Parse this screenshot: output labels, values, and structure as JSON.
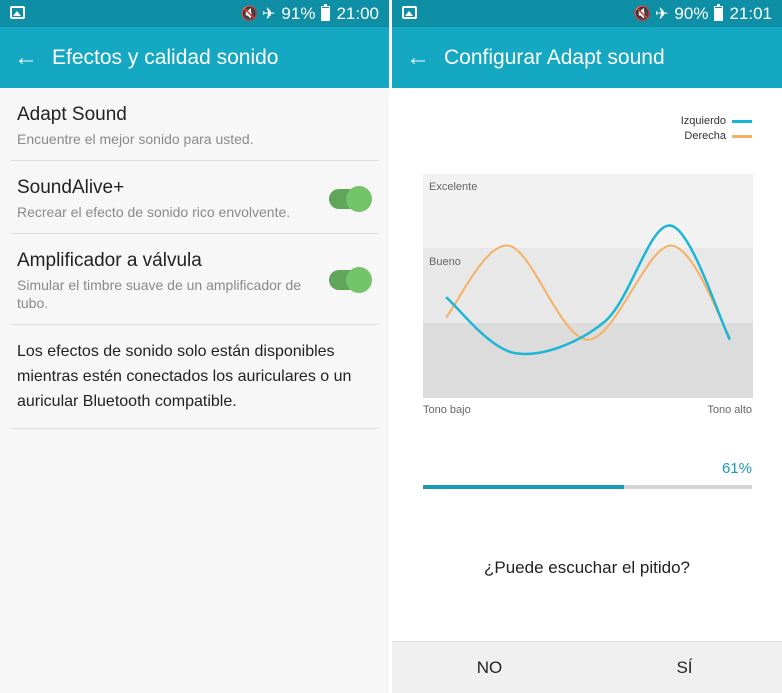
{
  "left": {
    "status": {
      "battery": "91%",
      "time": "21:00"
    },
    "appbar": {
      "title": "Efectos y calidad sonido"
    },
    "items": [
      {
        "title": "Adapt Sound",
        "subtitle": "Encuentre el mejor sonido para usted."
      },
      {
        "title": "SoundAlive+",
        "subtitle": "Recrear el efecto de sonido rico envolvente.",
        "toggle_on": true
      },
      {
        "title": "Amplificador a válvula",
        "subtitle": "Simular el timbre suave de un amplificador de tubo.",
        "toggle_on": true
      }
    ],
    "info": "Los efectos de sonido solo están disponibles mientras estén conectados los auriculares o un auricular Bluetooth compatible."
  },
  "right": {
    "status": {
      "battery": "90%",
      "time": "21:01"
    },
    "appbar": {
      "title": "Configurar Adapt sound"
    },
    "progress": {
      "label": "61%",
      "value": 0.61
    },
    "question": "¿Puede escuchar el pitido?",
    "buttons": {
      "no": "NO",
      "yes": "SÍ"
    }
  },
  "chart_data": {
    "type": "line",
    "bands": [
      "Excelente",
      "Bueno"
    ],
    "x_min_label": "Tono bajo",
    "x_max_label": "Tono alto",
    "xlim": [
      0,
      1
    ],
    "ylim": [
      0,
      1
    ],
    "series": [
      {
        "name": "Izquierdo",
        "color": "#1bb5d6",
        "x": [
          0.07,
          0.28,
          0.55,
          0.75,
          0.93
        ],
        "y": [
          0.45,
          0.2,
          0.34,
          0.77,
          0.26
        ]
      },
      {
        "name": "Derecha",
        "color": "#f5b063",
        "x": [
          0.07,
          0.26,
          0.5,
          0.75,
          0.93
        ],
        "y": [
          0.36,
          0.68,
          0.26,
          0.68,
          0.27
        ]
      }
    ]
  }
}
